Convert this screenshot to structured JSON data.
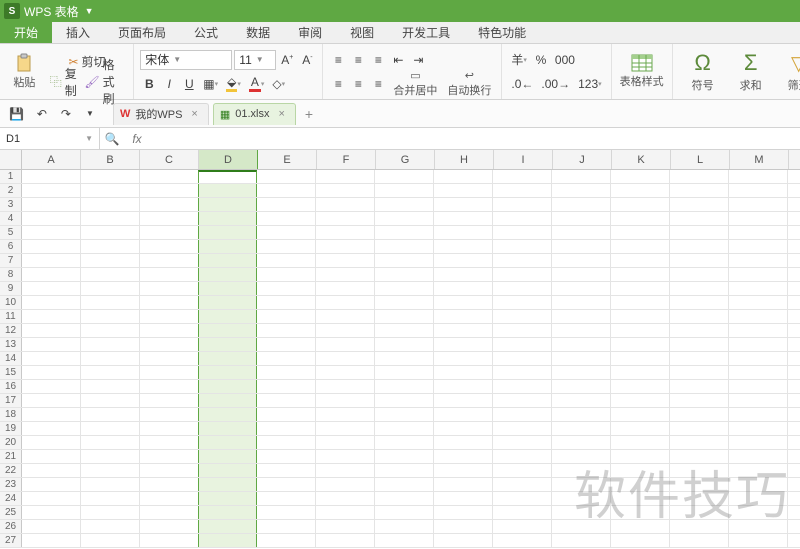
{
  "title_bar": {
    "app_name": "WPS 表格",
    "logo_letter": "S"
  },
  "menu_tabs": [
    "开始",
    "插入",
    "页面布局",
    "公式",
    "数据",
    "审阅",
    "视图",
    "开发工具",
    "特色功能"
  ],
  "menu_active_index": 0,
  "ribbon": {
    "clipboard": {
      "paste": "粘贴",
      "cut": "剪切",
      "copy": "复制",
      "format_painter": "格式刷"
    },
    "font": {
      "name": "宋体",
      "size": "11",
      "bold": "B",
      "italic": "I",
      "underline": "U"
    },
    "alignment": {
      "merge_center": "合并居中",
      "wrap_text": "自动换行"
    },
    "number": {
      "currency": "羊",
      "percent": "%"
    },
    "styles": {
      "table_style": "表格样式"
    },
    "editing": {
      "symbol": "符号",
      "autosum": "求和",
      "filter": "筛选"
    }
  },
  "doc_tabs": {
    "wps_home": "我的WPS",
    "files": [
      {
        "name": "01.xlsx",
        "active": true
      }
    ]
  },
  "formula_bar": {
    "name_box": "D1",
    "fx": "fx",
    "formula": ""
  },
  "grid": {
    "columns": [
      "A",
      "B",
      "C",
      "D",
      "E",
      "F",
      "G",
      "H",
      "I",
      "J",
      "K",
      "L",
      "M"
    ],
    "selected_column_index": 3,
    "row_count": 27,
    "active_cell": "D1"
  },
  "watermark": "软件技巧",
  "colors": {
    "brand": "#5fa843",
    "select_fill": "#e8f3df"
  }
}
